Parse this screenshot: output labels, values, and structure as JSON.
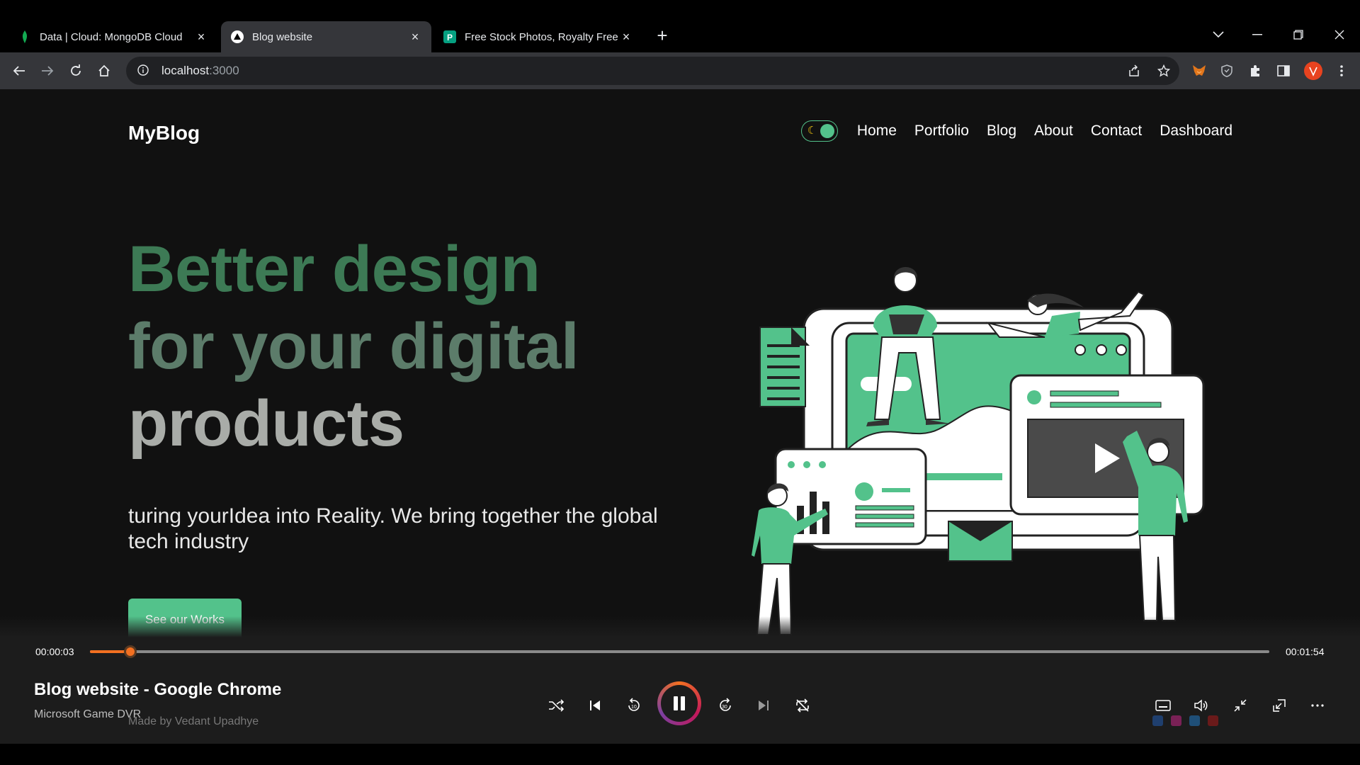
{
  "tabs": [
    {
      "title": "Data | Cloud: MongoDB Cloud",
      "favicon": "mongodb-leaf-icon"
    },
    {
      "title": "Blog website",
      "favicon": "vercel-triangle-icon"
    },
    {
      "title": "Free Stock Photos, Royalty Free S",
      "favicon": "pexels-icon"
    }
  ],
  "toolbar": {
    "url_host": "localhost",
    "url_port": ":3000"
  },
  "site": {
    "logo": "MyBlog",
    "nav": [
      "Home",
      "Portfolio",
      "Blog",
      "About",
      "Contact",
      "Dashboard"
    ],
    "toggle_icon": "moon-icon",
    "hero": {
      "line1": "Better design",
      "line2": "for your digital",
      "line3": "products",
      "description": "turing yourIdea into Reality. We bring together the global tech industry",
      "cta": "See our Works"
    },
    "credit": "Made by Vedant Upadhye",
    "colors": {
      "accent": "#53c28b",
      "heading_green": "#3d7a55",
      "background": "#111111"
    }
  },
  "player": {
    "current_time": "00:00:03",
    "total_time": "00:01:54",
    "progress": 0.034,
    "title": "Blog website - Google Chrome",
    "subtitle": "Microsoft Game DVR",
    "accent": "#f37021"
  }
}
